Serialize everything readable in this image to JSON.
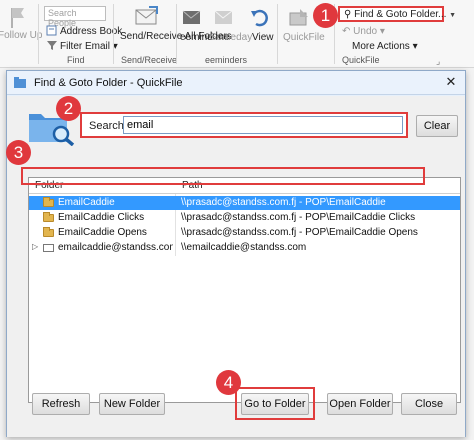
{
  "ribbon": {
    "follow_up": "Follow Up",
    "search_people_placeholder": "Search People",
    "address_book": "Address Book",
    "filter_email": "Filter Email",
    "find_group": "Find",
    "send_receive_all": "Send/Receive All Folders",
    "send_receive_group": "Send/Receive",
    "eeminder": "eemind me",
    "someday": "Someday",
    "eeminders_group": "eeminders",
    "view": "View",
    "quickfile": "QuickFile",
    "find_goto_folder": "Find & Goto Folder...",
    "undo": "Undo",
    "more_actions": "More Actions",
    "quickfile_group": "QuickFile"
  },
  "dialog": {
    "title": "Find & Goto Folder - QuickFile",
    "search_label": "Search:",
    "search_value": "email",
    "clear_button": "Clear",
    "columns": {
      "folder": "Folder",
      "path": "Path"
    },
    "rows": [
      {
        "folder": "EmailCaddie",
        "path": "\\\\prasadc@standss.com.fj - POP\\EmailCaddie",
        "selected": true
      },
      {
        "folder": "EmailCaddie Clicks",
        "path": "\\\\prasadc@standss.com.fj - POP\\EmailCaddie Clicks",
        "selected": false
      },
      {
        "folder": "EmailCaddie Opens",
        "path": "\\\\prasadc@standss.com.fj - POP\\EmailCaddie Opens",
        "selected": false
      },
      {
        "folder": "emailcaddie@standss.com",
        "path": "\\\\emailcaddie@standss.com",
        "selected": false
      }
    ],
    "buttons": {
      "refresh": "Refresh",
      "new_folder": "New Folder",
      "go_to_folder": "Go to Folder",
      "open_folder": "Open Folder",
      "close": "Close"
    }
  },
  "callouts": [
    "1",
    "2",
    "3",
    "4"
  ],
  "colors": {
    "callout": "#e0383d",
    "selection": "#3399ff"
  }
}
